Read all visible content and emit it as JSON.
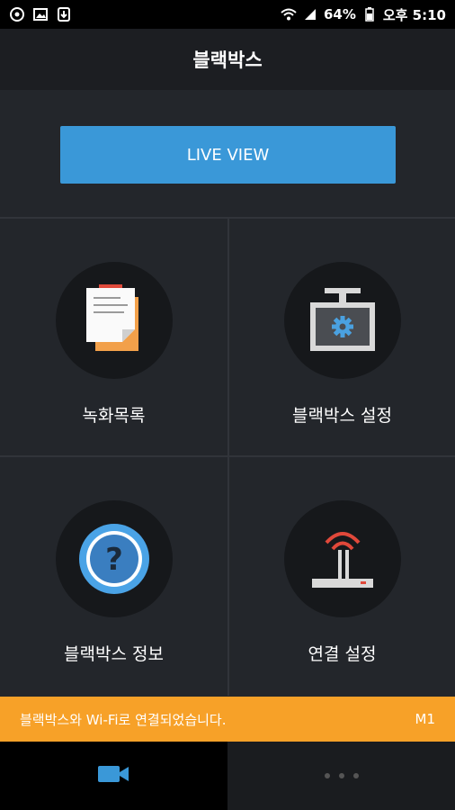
{
  "status_bar": {
    "battery": "64%",
    "time": "오후 5:10",
    "icons": [
      "app-icon",
      "image-icon",
      "download-icon",
      "wifi-icon",
      "signal-icon",
      "battery-icon"
    ]
  },
  "header": {
    "title": "블랙박스"
  },
  "live_view": {
    "label": "LIVE VIEW"
  },
  "menu": {
    "items": [
      {
        "label": "녹화목록",
        "icon": "recording-list-icon"
      },
      {
        "label": "블랙박스 설정",
        "icon": "blackbox-settings-icon"
      },
      {
        "label": "블랙박스 정보",
        "icon": "help-icon"
      },
      {
        "label": "연결 설정",
        "icon": "router-icon"
      }
    ]
  },
  "notice": {
    "message": "블랙박스와 Wi-Fi로 연결되었습니다.",
    "model": "M1"
  },
  "bottom_nav": {
    "tabs": [
      {
        "icon": "video-camera-icon",
        "active": true
      },
      {
        "icon": "more-icon",
        "active": false
      }
    ]
  },
  "colors": {
    "accent": "#3a98d8",
    "notice": "#f7a128",
    "background": "#23262b",
    "router_wifi": "#e0483a"
  }
}
